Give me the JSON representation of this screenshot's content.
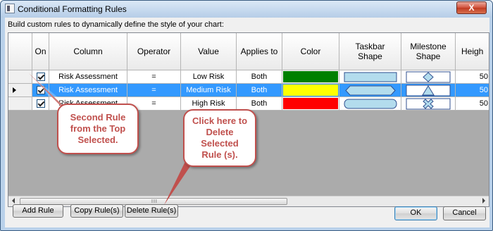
{
  "window": {
    "title": "Conditional Formatting Rules",
    "close_label": "X"
  },
  "subtitle": "Build custom rules to dynamically define the style of your chart:",
  "columns": [
    {
      "label": "On"
    },
    {
      "label": "Column"
    },
    {
      "label": "Operator"
    },
    {
      "label": "Value"
    },
    {
      "label": "Applies to"
    },
    {
      "label": "Color"
    },
    {
      "label": "Taskbar Shape"
    },
    {
      "label": "Milestone Shape"
    },
    {
      "label": "Heigh"
    }
  ],
  "rows": [
    {
      "on": true,
      "column": "Risk Assessment",
      "operator": "=",
      "value": "Low Risk",
      "applies_to": "Both",
      "color": "#008000",
      "taskbar_shape": "rectangle",
      "milestone_shape": "diamond",
      "height": "50",
      "selected": false
    },
    {
      "on": true,
      "column": "Risk Assessment",
      "operator": "=",
      "value": "Medium Risk",
      "applies_to": "Both",
      "color": "#ffff00",
      "taskbar_shape": "hexagon",
      "milestone_shape": "triangle",
      "height": "50",
      "selected": true
    },
    {
      "on": true,
      "column": "Risk Assessment",
      "operator": "=",
      "value": "High Risk",
      "applies_to": "Both",
      "color": "#ff0000",
      "taskbar_shape": "rounded",
      "milestone_shape": "x-cross",
      "height": "50",
      "selected": false
    }
  ],
  "scroll_grip": "III",
  "buttons": {
    "add_rule": "Add Rule",
    "copy_rules": "Copy Rule(s)",
    "delete_rules": "Delete Rule(s)",
    "ok": "OK",
    "cancel": "Cancel"
  },
  "callouts": {
    "second_rule": "Second Rule from the Top Selected.",
    "delete_hint": "Click here to Delete Selected Rule (s)."
  },
  "colors": {
    "selection": "#3399ff",
    "callout": "#c0504d",
    "shape_fill": "#b3dced",
    "shape_stroke": "#2f4f8f"
  }
}
